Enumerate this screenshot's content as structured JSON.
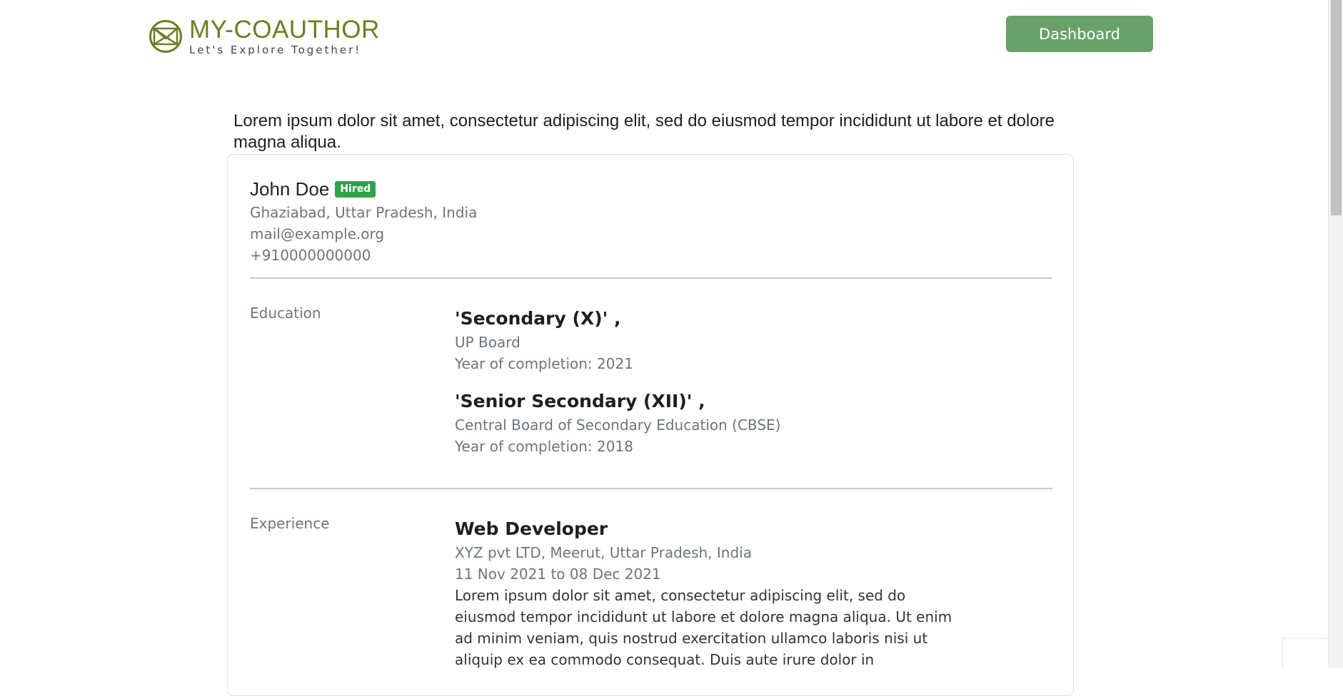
{
  "header": {
    "brand_name": "MY-COAUTHOR",
    "brand_tagline": "Let's Explore Together!",
    "dashboard_label": "Dashboard"
  },
  "intro_text": "Lorem ipsum dolor sit amet, consectetur adipiscing elit, sed do eiusmod tempor incididunt ut labore et dolore magna aliqua.",
  "profile": {
    "name": "John Doe",
    "status": "Hired",
    "location": "Ghaziabad, Uttar Pradesh, India",
    "email": "mail@example.org",
    "phone": "+910000000000"
  },
  "education": {
    "label": "Education",
    "items": [
      {
        "title": "'Secondary (X)' ,",
        "board": "UP Board",
        "year": "Year of completion: 2021"
      },
      {
        "title": "'Senior Secondary (XII)' ,",
        "board": "Central Board of Secondary Education (CBSE)",
        "year": "Year of completion: 2018"
      }
    ]
  },
  "experience": {
    "label": "Experience",
    "items": [
      {
        "title": "Web Developer",
        "company": "XYZ pvt LTD, Meerut, Uttar Pradesh, India",
        "dates": "11 Nov 2021 to 08 Dec 2021",
        "description": "Lorem ipsum dolor sit amet, consectetur adipiscing elit, sed do eiusmod tempor incididunt ut labore et dolore magna aliqua. Ut enim ad minim veniam, quis nostrud exercitation ullamco laboris nisi ut aliquip ex ea commodo consequat. Duis aute irure dolor in"
      }
    ]
  },
  "colors": {
    "brand": "#6f7d22",
    "primary_button": "#6aa16b",
    "badge_hired": "#2fa24a",
    "muted_text": "#6c757d"
  },
  "icons": {
    "logo": "envelope-triangle-logo-icon"
  }
}
